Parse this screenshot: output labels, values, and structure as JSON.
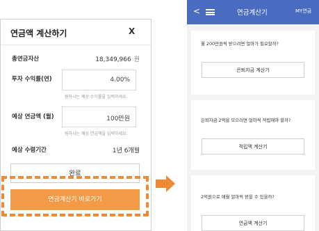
{
  "left_panel": {
    "title": "연금액 계산하기",
    "close_label": "X",
    "total_assets": {
      "label": "총연금자산",
      "value": "18,349,966",
      "unit": "원"
    },
    "return_rate": {
      "label": "투자 수익률(연)",
      "value": "4.00%",
      "hint": "원하시는 예상 수익률을 입력하세요."
    },
    "expected_pension": {
      "label": "예상 연금액 (월)",
      "value": "100만원",
      "hint": "원하시는 예상 연금액을 입력하세요."
    },
    "period": {
      "label": "예상 수령기간",
      "value": "1년 6개월"
    },
    "reset_label": "완료",
    "go_button_label": "연금계산기 바로가기"
  },
  "right_panel": {
    "title": "연금계산기",
    "my_label": "MY연금",
    "back_glyph": "<",
    "cards": [
      {
        "question": "월 200만원씩 받으려면 얼마가 필요할까?",
        "button": "은퇴자금 계산기"
      },
      {
        "question": "은퇴자금 2억을 모으려면 얼마씩 적립해야 할까?",
        "button": "적립액 계산기"
      },
      {
        "question": "2억원으로 매월 얼마씩 받을 수 있을까?",
        "button": "연금액 계산기"
      }
    ]
  },
  "colors": {
    "accent_orange": "#f29a45",
    "dashed_highlight": "#ee8a36",
    "header_blue": "#4a6cc0"
  }
}
